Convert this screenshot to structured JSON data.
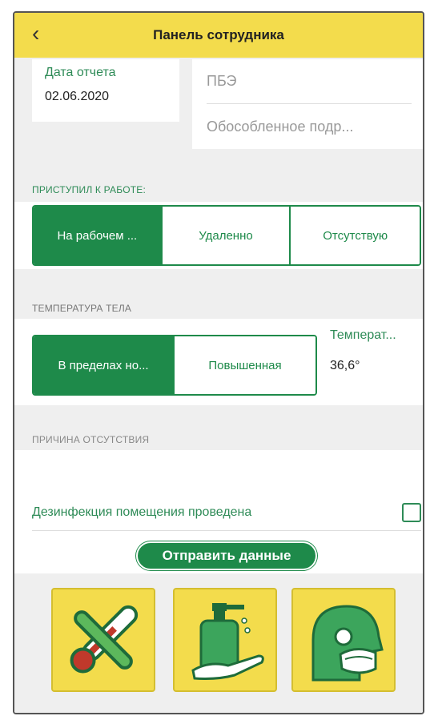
{
  "header": {
    "title": "Панель сотрудника",
    "back_icon": "chevron-left-icon"
  },
  "report": {
    "date_label": "Дата отчета",
    "date_value": "02.06.2020",
    "field1": "ПБЭ",
    "field2": "Обособленное подр..."
  },
  "work": {
    "label": "ПРИСТУПИЛ К РАБОТЕ:",
    "options": [
      "На рабочем ...",
      "Удаленно",
      "Отсутствую"
    ],
    "selected": "На рабочем ..."
  },
  "temperature": {
    "label": "ТЕМПЕРАТУРА ТЕЛА",
    "options": [
      "В пределах но...",
      "Повышенная"
    ],
    "selected": "В пределах но...",
    "value_label": "Температ...",
    "value": "36,6°"
  },
  "absence": {
    "label": "ПРИЧИНА ОТСУТСТВИЯ"
  },
  "disinfection": {
    "label": "Дезинфекция помещения проведена",
    "checked": false
  },
  "submit": {
    "label": "Отправить данные"
  },
  "icons": [
    "thermometer-icon",
    "sanitizer-icon",
    "face-mask-icon"
  ],
  "colors": {
    "accent": "#1e8a4a",
    "header": "#f3dc4c"
  }
}
